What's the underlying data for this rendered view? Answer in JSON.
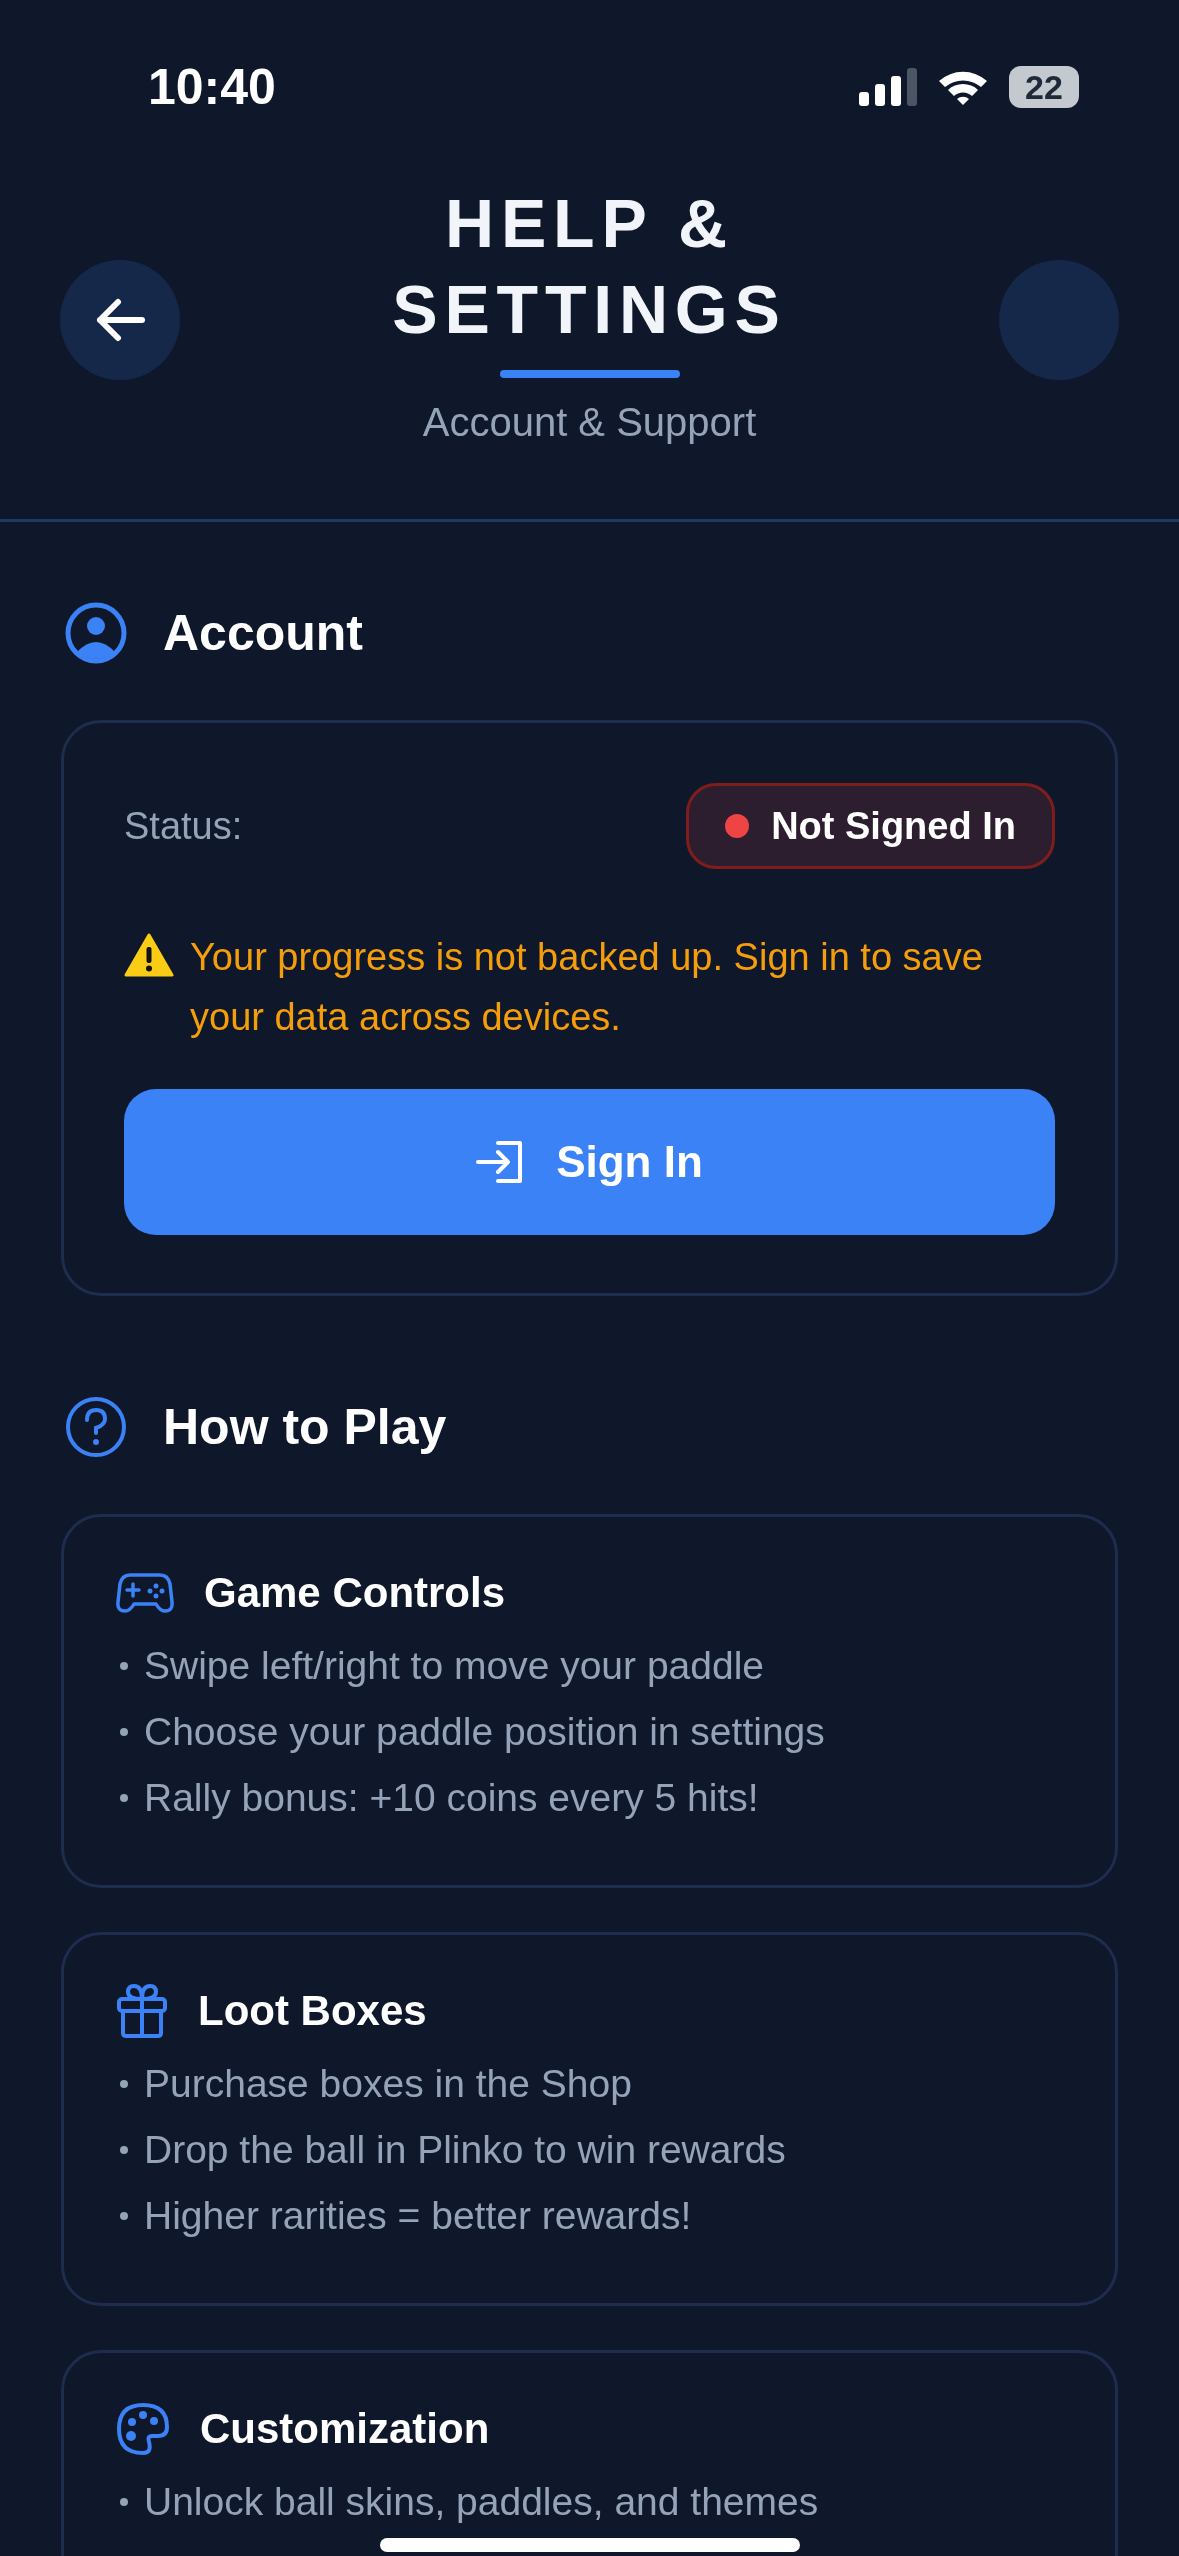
{
  "status_bar": {
    "time": "10:40",
    "battery": "22"
  },
  "header": {
    "title": "HELP & SETTINGS",
    "subtitle": "Account & Support"
  },
  "account": {
    "heading": "Account",
    "status_label": "Status:",
    "status": {
      "text": "Not Signed In",
      "color": "#ef4444"
    },
    "warning": "Your progress is not backed up. Sign in to save your data across devices.",
    "button": "Sign In"
  },
  "how_to_play": {
    "heading": "How to Play",
    "cards": [
      {
        "kind": "controls",
        "title": "Game Controls",
        "items": [
          "Swipe left/right to move your paddle",
          "Choose your paddle position in settings",
          "Rally bonus: +10 coins every 5 hits!"
        ]
      },
      {
        "kind": "loot",
        "title": "Loot Boxes",
        "items": [
          "Purchase boxes in the Shop",
          "Drop the ball in Plinko to win rewards",
          "Higher rarities = better rewards!"
        ]
      },
      {
        "kind": "custom",
        "title": "Customization",
        "items": [
          "Unlock ball skins, paddles, and themes"
        ]
      }
    ]
  }
}
